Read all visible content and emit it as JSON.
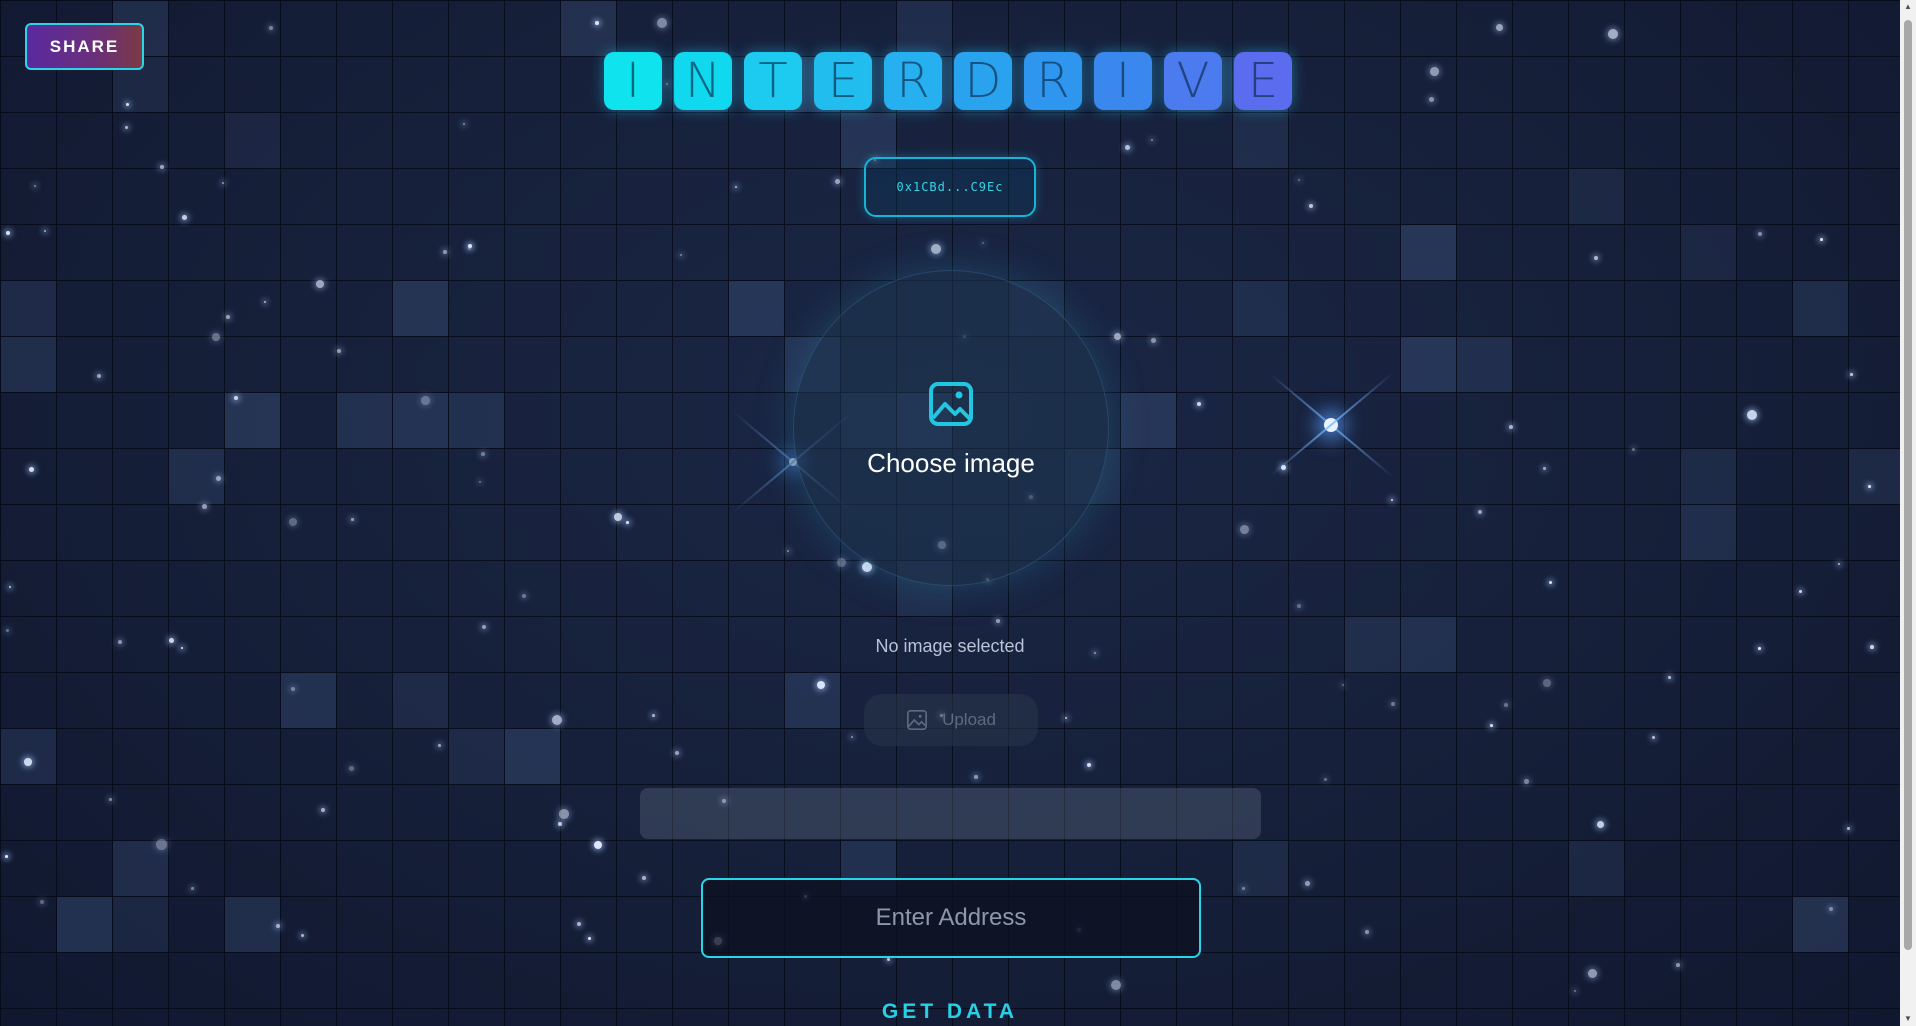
{
  "share_label": "SHARE",
  "title_letters": [
    "I",
    "N",
    "T",
    "E",
    "R",
    "D",
    "R",
    "I",
    "V",
    "E"
  ],
  "title_colors": [
    "#0fe3ee",
    "#10d8ef",
    "#1ccbef",
    "#21bdef",
    "#26b0ef",
    "#2aa3ef",
    "#2e96ee",
    "#3a88ee",
    "#4c7aef",
    "#5b6cee"
  ],
  "wallet_address": "0x1CBd...C9Ec",
  "upload_area": {
    "icon": "image-icon",
    "label": "Choose image"
  },
  "file_status": "No image selected",
  "upload_button": {
    "icon": "image-icon",
    "label": "Upload"
  },
  "address_input": {
    "placeholder": "Enter Address",
    "value": ""
  },
  "get_data_label": "GET DATA",
  "accent_color": "#28d4e8"
}
